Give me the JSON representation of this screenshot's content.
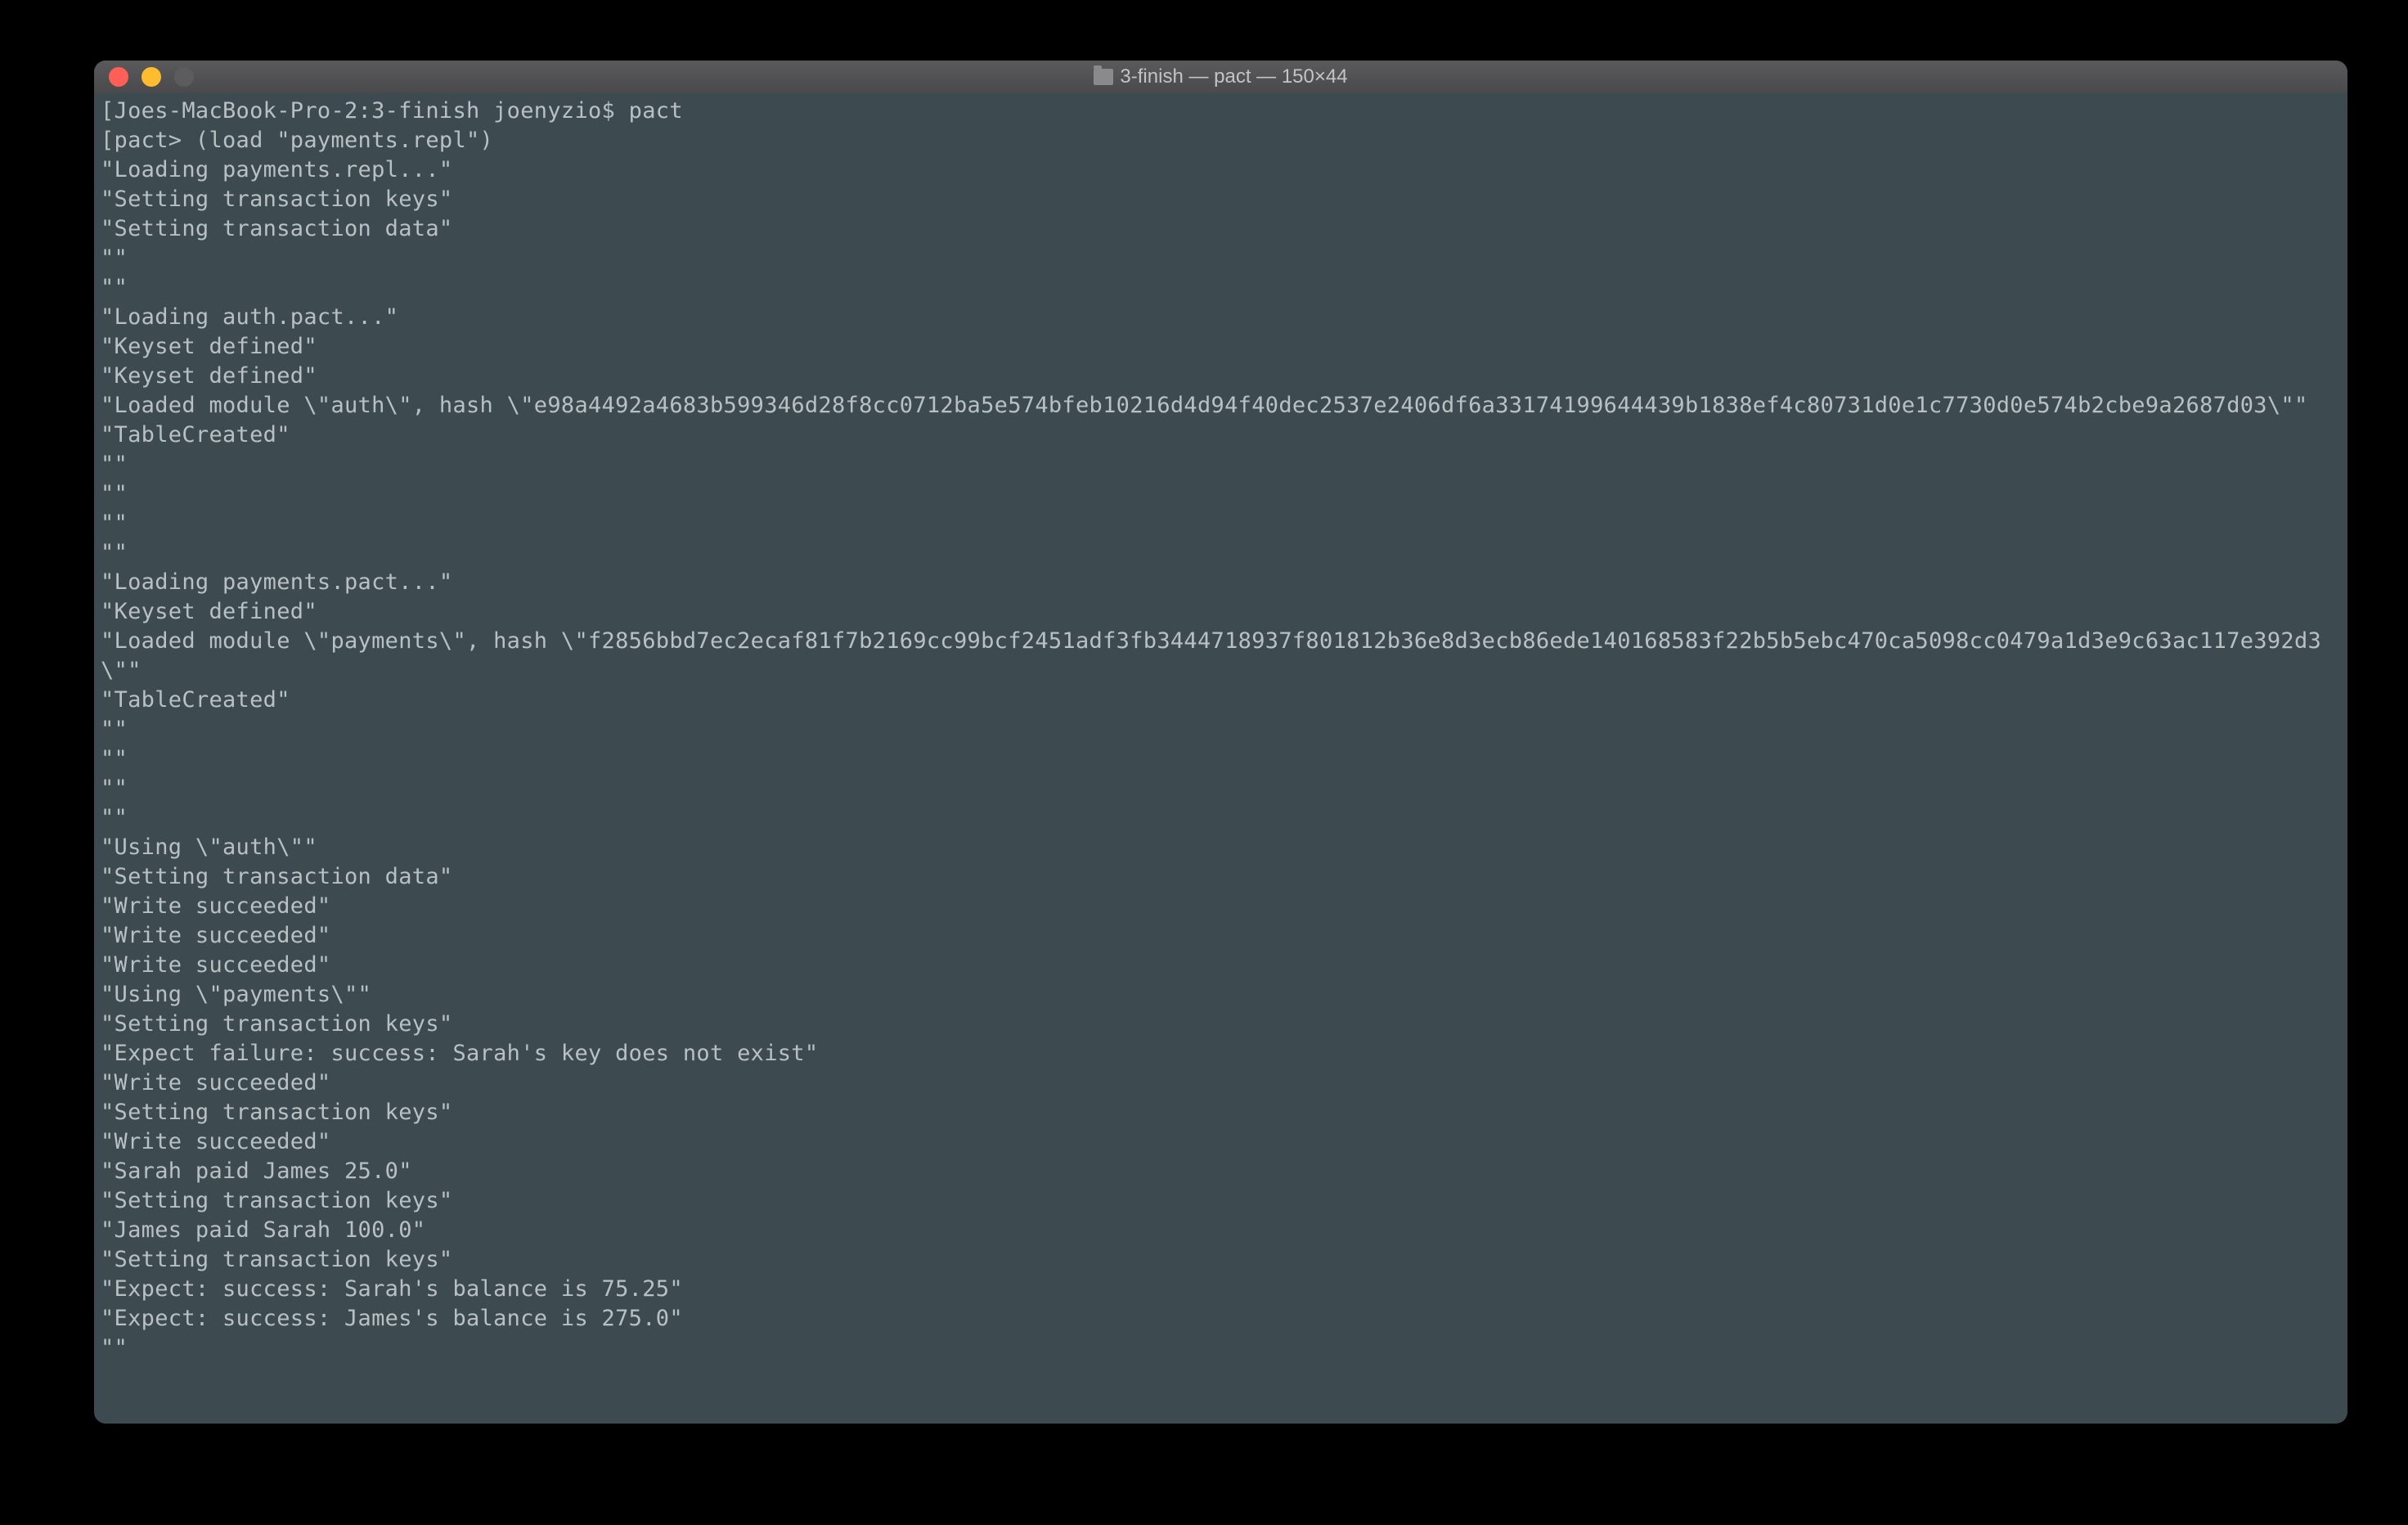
{
  "window": {
    "title": "3-finish — pact — 150×44"
  },
  "terminal": {
    "prompt": "[Joes-MacBook-Pro-2:3-finish joenyzio$ pact",
    "replLine": "[pact> (load \"payments.repl\")",
    "output": [
      "\"Loading payments.repl...\"",
      "\"Setting transaction keys\"",
      "\"Setting transaction data\"",
      "\"\"",
      "\"\"",
      "\"Loading auth.pact...\"",
      "\"Keyset defined\"",
      "\"Keyset defined\"",
      "\"Loaded module \\\"auth\\\", hash \\\"e98a4492a4683b599346d28f8cc0712ba5e574bfeb10216d4d94f40dec2537e2406df6a33174199644439b1838ef4c80731d0e1c7730d0e574b2cbe9a2687d03\\\"\"",
      "\"TableCreated\"",
      "\"\"",
      "\"\"",
      "\"\"",
      "\"\"",
      "\"Loading payments.pact...\"",
      "\"Keyset defined\"",
      "\"Loaded module \\\"payments\\\", hash \\\"f2856bbd7ec2ecaf81f7b2169cc99bcf2451adf3fb3444718937f801812b36e8d3ecb86ede140168583f22b5b5ebc470ca5098cc0479a1d3e9c63ac117e392d3\\\"\"",
      "\"TableCreated\"",
      "\"\"",
      "\"\"",
      "\"\"",
      "\"\"",
      "\"Using \\\"auth\\\"\"",
      "\"Setting transaction data\"",
      "\"Write succeeded\"",
      "\"Write succeeded\"",
      "\"Write succeeded\"",
      "\"Using \\\"payments\\\"\"",
      "\"Setting transaction keys\"",
      "\"Expect failure: success: Sarah's key does not exist\"",
      "\"Write succeeded\"",
      "\"Setting transaction keys\"",
      "\"Write succeeded\"",
      "\"Sarah paid James 25.0\"",
      "\"Setting transaction keys\"",
      "\"James paid Sarah 100.0\"",
      "\"Setting transaction keys\"",
      "\"Expect: success: Sarah's balance is 75.25\"",
      "\"Expect: success: James's balance is 275.0\"",
      "\"\""
    ]
  }
}
